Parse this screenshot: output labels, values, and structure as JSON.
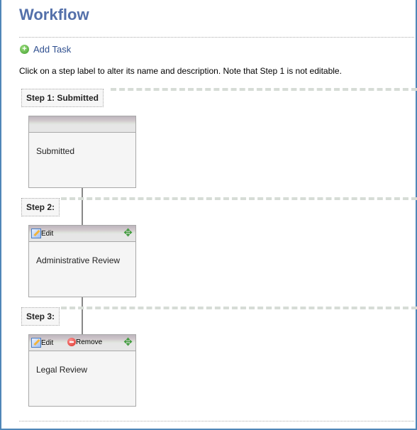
{
  "page": {
    "title": "Workflow",
    "add_task_label": "Add Task",
    "instructions": "Click on a step label to alter its name and description. Note that Step 1 is not editable."
  },
  "steps": [
    {
      "label": "Step 1: Submitted",
      "task": "Submitted",
      "actions": []
    },
    {
      "label": "Step 2:",
      "task": "Administrative Review",
      "actions": [
        "Edit"
      ]
    },
    {
      "label": "Step 3:",
      "task": "Legal Review",
      "actions": [
        "Edit",
        "Remove"
      ]
    }
  ],
  "icons": {
    "add": "plus-circle",
    "edit": "pencil",
    "remove": "minus-circle",
    "move": "four-way-arrow"
  },
  "colors": {
    "title": "#5470aa",
    "border": "#4f86b8",
    "link": "#2f4f8f"
  }
}
